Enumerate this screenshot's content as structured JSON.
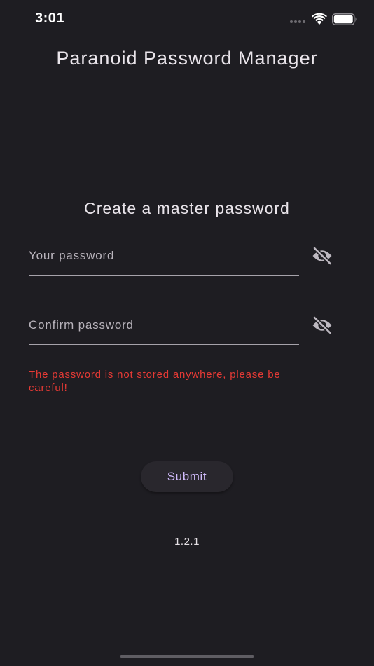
{
  "status_bar": {
    "time": "3:01",
    "icons": [
      "signal-dots-icon",
      "wifi-icon",
      "battery-icon"
    ]
  },
  "app": {
    "title": "Paranoid Password Manager"
  },
  "form": {
    "heading": "Create a master password",
    "password_field": {
      "placeholder": "Your password",
      "value": "",
      "toggle_icon": "eye-off-icon"
    },
    "confirm_field": {
      "placeholder": "Confirm password",
      "value": "",
      "toggle_icon": "eye-off-icon"
    },
    "warning": "The password is not stored anywhere, please be careful!",
    "submit_label": "Submit"
  },
  "footer": {
    "version": "1.2.1"
  },
  "colors": {
    "background": "#1e1d22",
    "text": "#e6e1e6",
    "warning": "#e53a35",
    "accent": "#d2bcfd",
    "button_bg": "#29272d"
  }
}
